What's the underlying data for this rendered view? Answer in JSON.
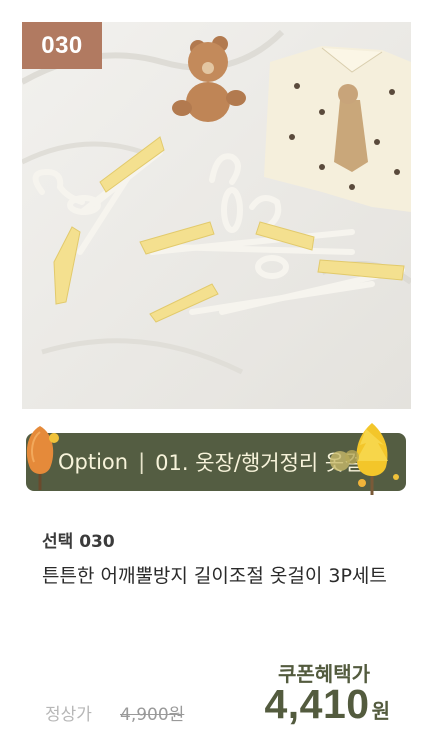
{
  "product": {
    "badge": "030",
    "image_alt": "옷걸이 제품 사진",
    "option": {
      "label": "Option",
      "separator": "|",
      "value": "01. 옷장/행거정리 옷걸이"
    },
    "select_label": "선택 030",
    "title": "튼튼한 어깨뿔방지 길이조절 옷걸이 3P세트",
    "coupon_label": "쿠폰혜택가",
    "regular_price_label": "정상가",
    "regular_price": "4,900원",
    "sale_price": "4,410",
    "sale_currency": "원"
  },
  "colors": {
    "badge_bg": "#b17a61",
    "option_bar_bg": "#545d42",
    "accent_green": "#535b3e",
    "hanger_yellow": "#f4e08f"
  }
}
